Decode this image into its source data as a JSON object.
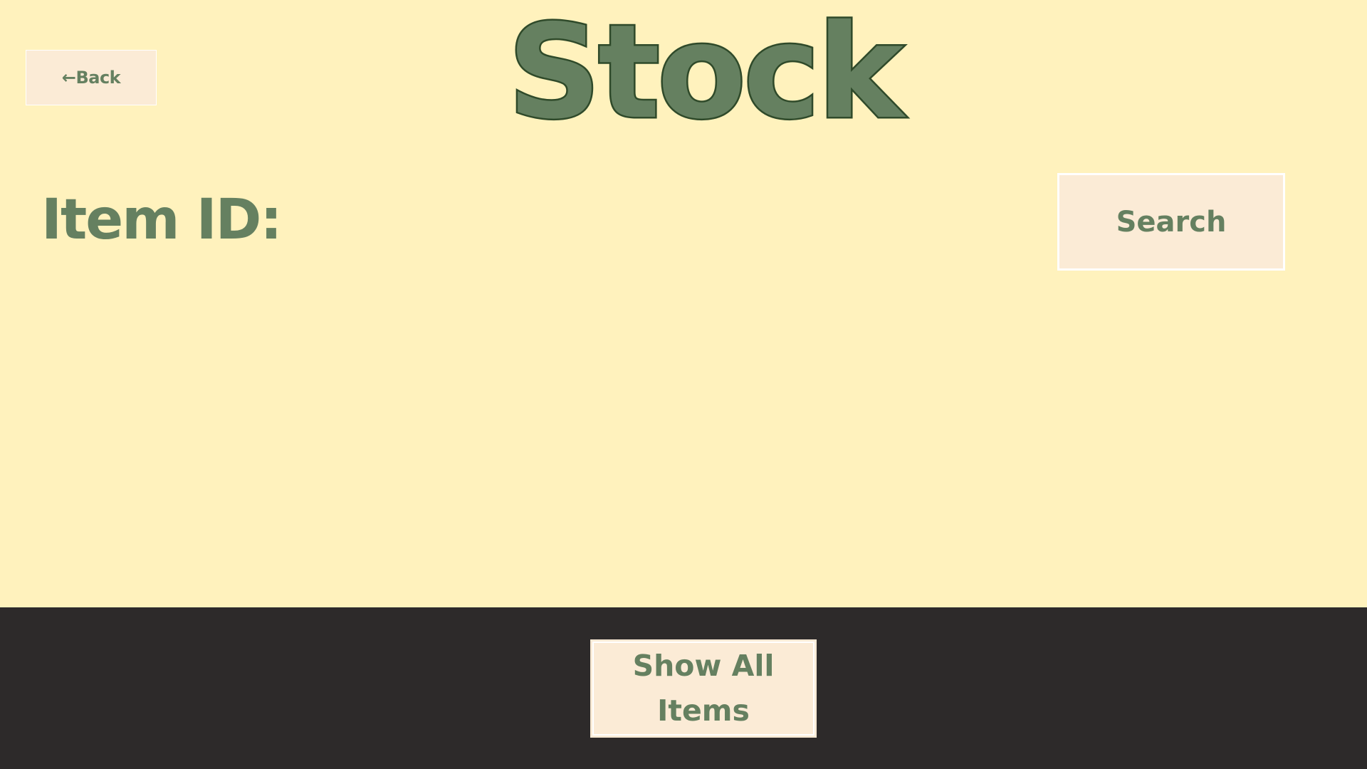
{
  "header": {
    "title": "Stock",
    "back_label": "←Back"
  },
  "search": {
    "item_id_label": "Item ID:",
    "search_label": "Search"
  },
  "footer": {
    "show_all_label": "Show All Items"
  }
}
